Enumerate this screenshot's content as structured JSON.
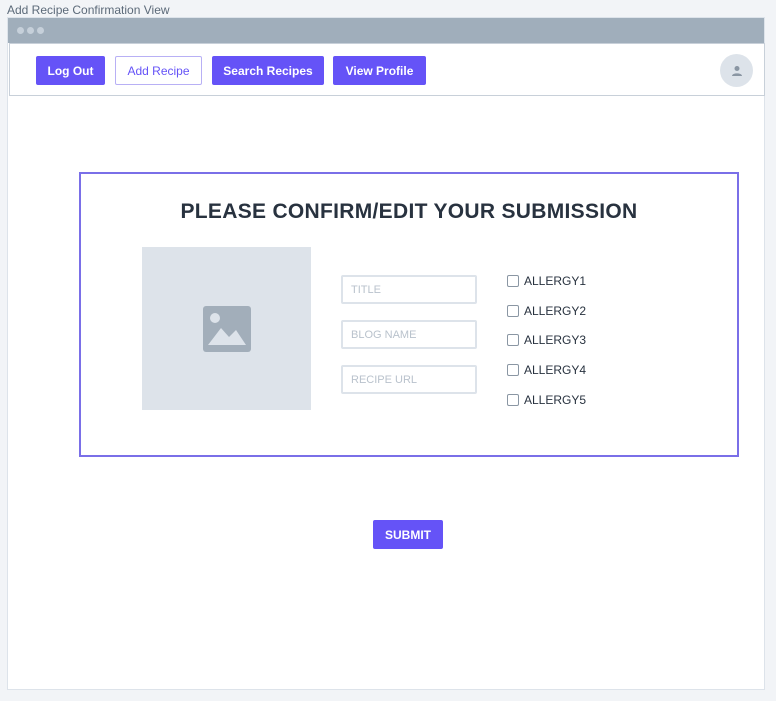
{
  "page_label": "Add Recipe Confirmation View",
  "nav": {
    "logout_label": "Log Out",
    "add_recipe_label": "Add Recipe",
    "search_recipes_label": "Search Recipes",
    "view_profile_label": "View Profile"
  },
  "form": {
    "title": "PLEASE CONFIRM/EDIT YOUR SUBMISSION",
    "title_placeholder": "TITLE",
    "blog_name_placeholder": "BLOG NAME",
    "recipe_url_placeholder": "RECIPE URL",
    "allergies": [
      "ALLERGY1",
      "ALLERGY2",
      "ALLERGY3",
      "ALLERGY4",
      "ALLERGY5"
    ],
    "submit_label": "SUBMIT"
  },
  "colors": {
    "accent": "#6553f7",
    "frame_border": "#7a6fe8",
    "placeholder_bg": "#dde3ea",
    "titlebar": "#a0aebb"
  },
  "icons": {
    "avatar": "user-icon",
    "image_placeholder": "image-icon"
  }
}
